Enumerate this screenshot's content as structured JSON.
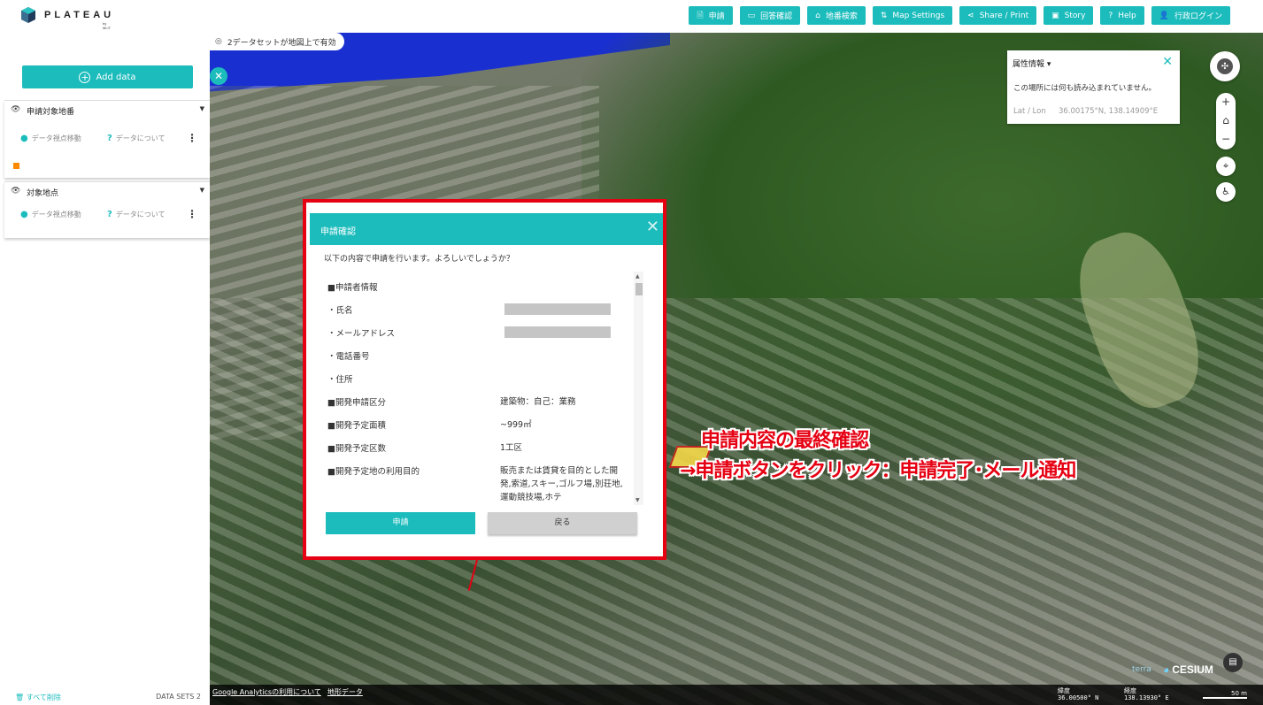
{
  "header": {
    "logo_text": "PLATEAU",
    "logo_sub": "by MLIT",
    "nav": [
      {
        "icon": "document-icon",
        "glyph": "🗎",
        "label": "申請"
      },
      {
        "icon": "answer-icon",
        "glyph": "▭",
        "label": "回答確認"
      },
      {
        "icon": "lot-search-icon",
        "glyph": "⌂",
        "label": "地番検索"
      },
      {
        "icon": "map-settings-icon",
        "glyph": "⇅",
        "label": "Map Settings"
      },
      {
        "icon": "share-icon",
        "glyph": "⋖",
        "label": "Share / Print"
      },
      {
        "icon": "story-icon",
        "glyph": "▣",
        "label": "Story"
      },
      {
        "icon": "help-icon",
        "glyph": "?",
        "label": "Help"
      },
      {
        "icon": "user-icon",
        "glyph": "👤",
        "label": "行政ログイン"
      }
    ]
  },
  "sidebar": {
    "add_data": "Add data",
    "layers": [
      {
        "title": "申請対象地番",
        "action_zoom": "データ視点移動",
        "action_about": "データについて"
      },
      {
        "title": "対象地点",
        "action_zoom": "データ視点移動",
        "action_about": "データについて"
      }
    ],
    "clear_all": "すべて削除",
    "datasets_count": "DATA SETS 2"
  },
  "map": {
    "datasets_badge": "2データセットが地図上で有効",
    "feature_info": {
      "title": "属性情報",
      "message": "この場所には何も読み込まれていません。",
      "latlon_label": "Lat / Lon",
      "latlon_value": "36.00175°N, 138.14909°E"
    },
    "bottom_links": [
      "Google Analyticsの利用について",
      "地形データ"
    ],
    "lat_label": "緯度",
    "lat_value": "36.00500° N",
    "lon_label": "経度",
    "lon_value": "138.13930° E",
    "scale": "50 m",
    "cesium": "CESIUM",
    "terra": "terra"
  },
  "dialog": {
    "title": "申請確認",
    "subtitle": "以下の内容で申請を行います。よろしいでしょうか？",
    "rows": [
      {
        "key": "■申請者情報",
        "value": ""
      },
      {
        "key": "・氏名",
        "value": ""
      },
      {
        "key": "・メールアドレス",
        "value": ""
      },
      {
        "key": "・電話番号",
        "value": ""
      },
      {
        "key": "・住所",
        "value": ""
      },
      {
        "key": "■開発申請区分",
        "value": "建築物：自己：業務"
      },
      {
        "key": "■開発予定面積",
        "value": "~999㎡"
      },
      {
        "key": "■開発予定区数",
        "value": "1工区"
      },
      {
        "key": "■開発予定地の利用目的",
        "value": "販売または賃貸を目的とした開発,索道,スキー,ゴルフ場,別荘地,運動競技場,ホテ"
      }
    ],
    "submit": "申請",
    "back": "戻る"
  },
  "annotation": {
    "line1": "申請内容の最終確認",
    "line2": "→申請ボタンをクリック：申請完了･メール通知"
  }
}
